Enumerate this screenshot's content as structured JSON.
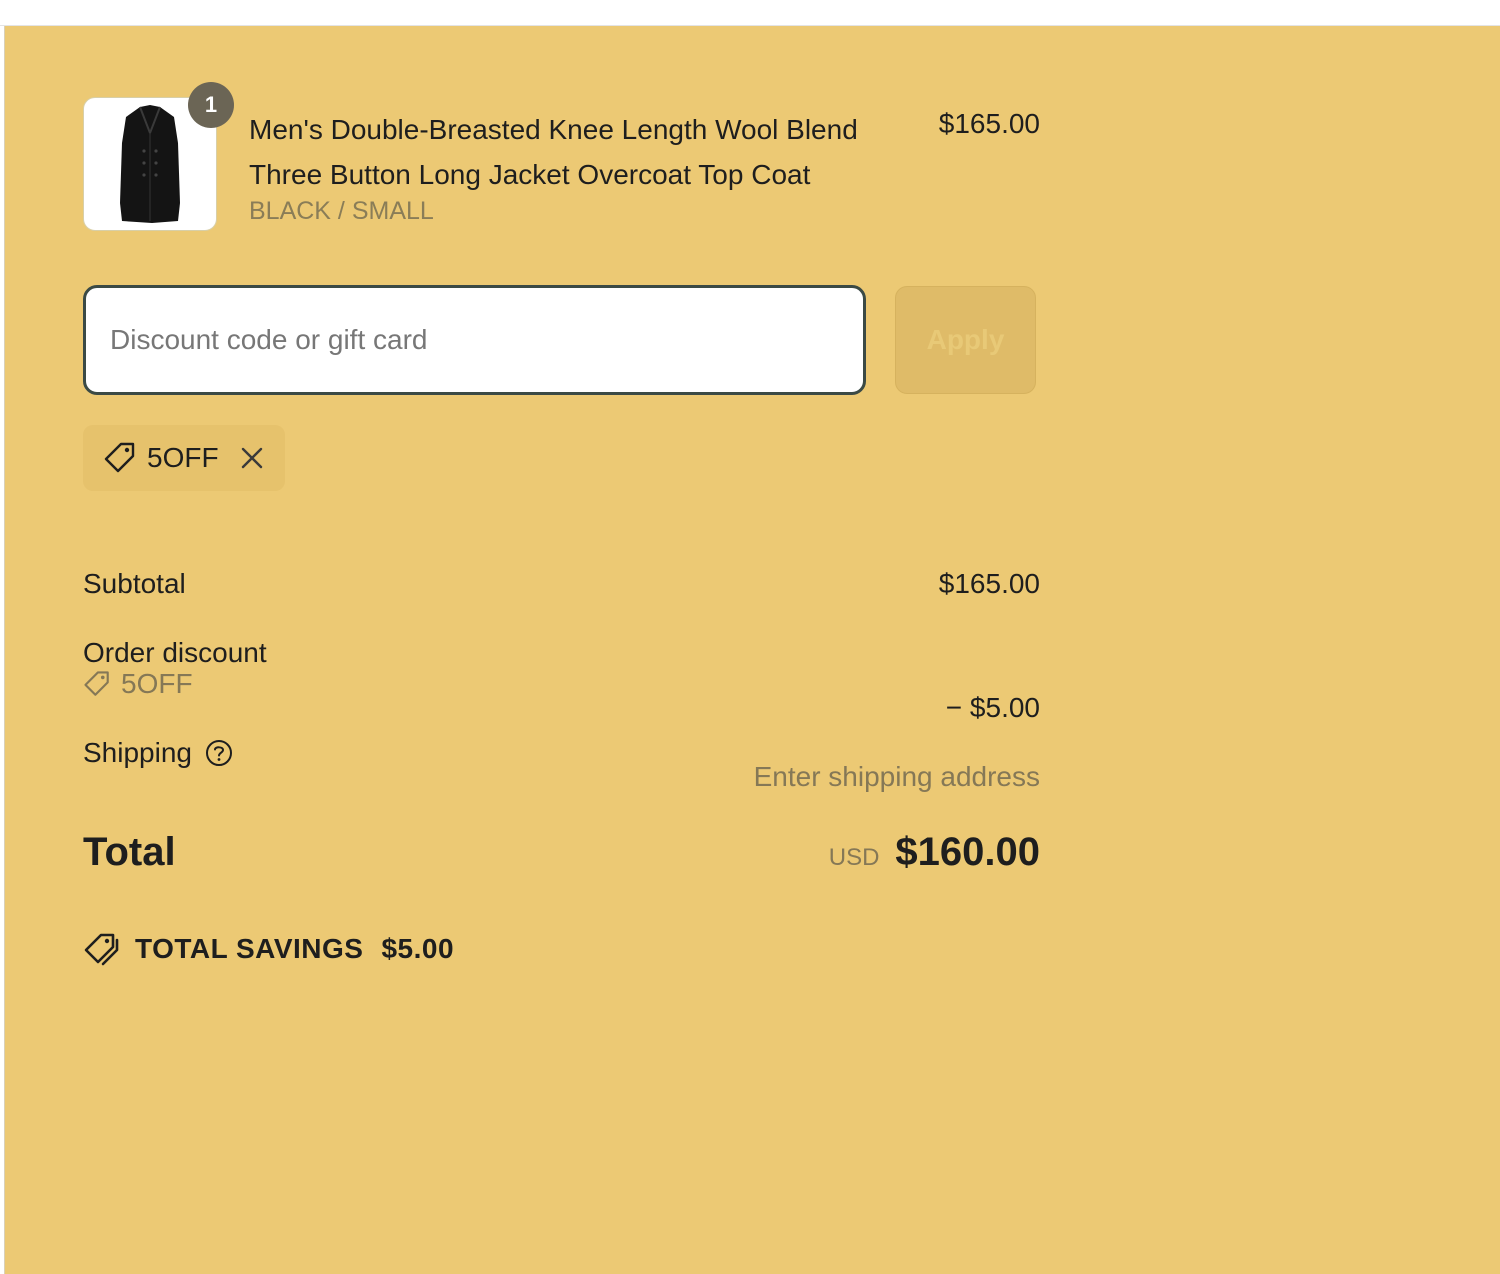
{
  "product": {
    "quantity": "1",
    "title": "Men's Double-Breasted Knee Length Wool Blend Three Button Long Jacket Overcoat Top Coat",
    "variant": "BLACK / SMALL",
    "price": "$165.00",
    "image_icon": "overcoat-image"
  },
  "discount": {
    "placeholder": "Discount code or gift card",
    "value": "",
    "apply_label": "Apply",
    "applied_code": "5OFF"
  },
  "summary": {
    "subtotal_label": "Subtotal",
    "subtotal_value": "$165.00",
    "order_discount_label": "Order discount",
    "discount_code": "5OFF",
    "discount_value": "− $5.00",
    "shipping_label": "Shipping",
    "shipping_value": "Enter shipping address",
    "total_label": "Total",
    "currency": "USD",
    "total_value": "$160.00",
    "savings_label": "TOTAL SAVINGS",
    "savings_value": "$5.00"
  },
  "colors": {
    "background": "#ecc974",
    "input_border": "#3b4a45",
    "apply_button": "#dfbb68",
    "muted_text": "#857856"
  }
}
